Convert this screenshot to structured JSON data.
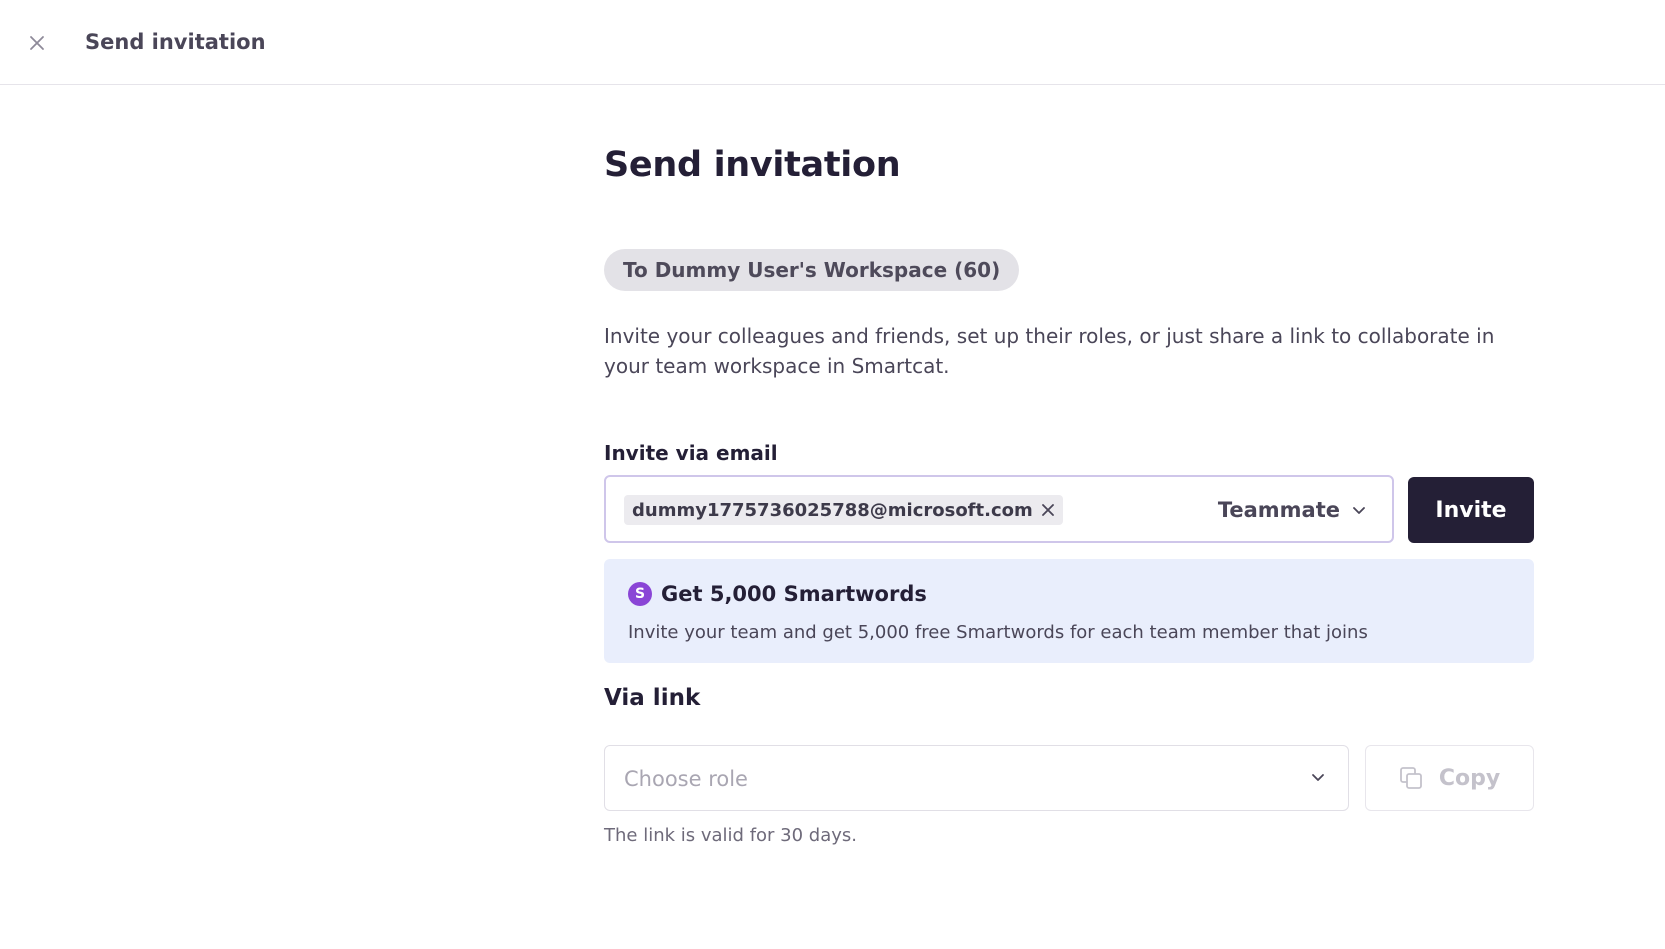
{
  "topbar": {
    "title": "Send invitation",
    "close_icon": "close-icon"
  },
  "main": {
    "title": "Send invitation",
    "workspace_chip": "To Dummy User's Workspace (60)",
    "description": "Invite your colleagues and friends, set up their roles, or just share a link to collaborate in your team workspace in Smartcat."
  },
  "invite_email": {
    "label": "Invite via email",
    "email_tag": "dummy1775736025788@microsoft.com",
    "role_value": "Teammate",
    "invite_label": "Invite"
  },
  "promo": {
    "icon_letter": "S",
    "title": "Get 5,000 Smartwords",
    "text": "Invite your team and get 5,000 free Smartwords for each team member that joins"
  },
  "via_link": {
    "label": "Via link",
    "role_placeholder": "Choose role",
    "copy_label": "Copy",
    "note": "The link is valid for 30 days."
  },
  "colors": {
    "primary_dark": "#241f36",
    "promo_bg": "#e9eefc",
    "promo_icon": "#8a45d6",
    "email_border": "#cfc6ea"
  }
}
